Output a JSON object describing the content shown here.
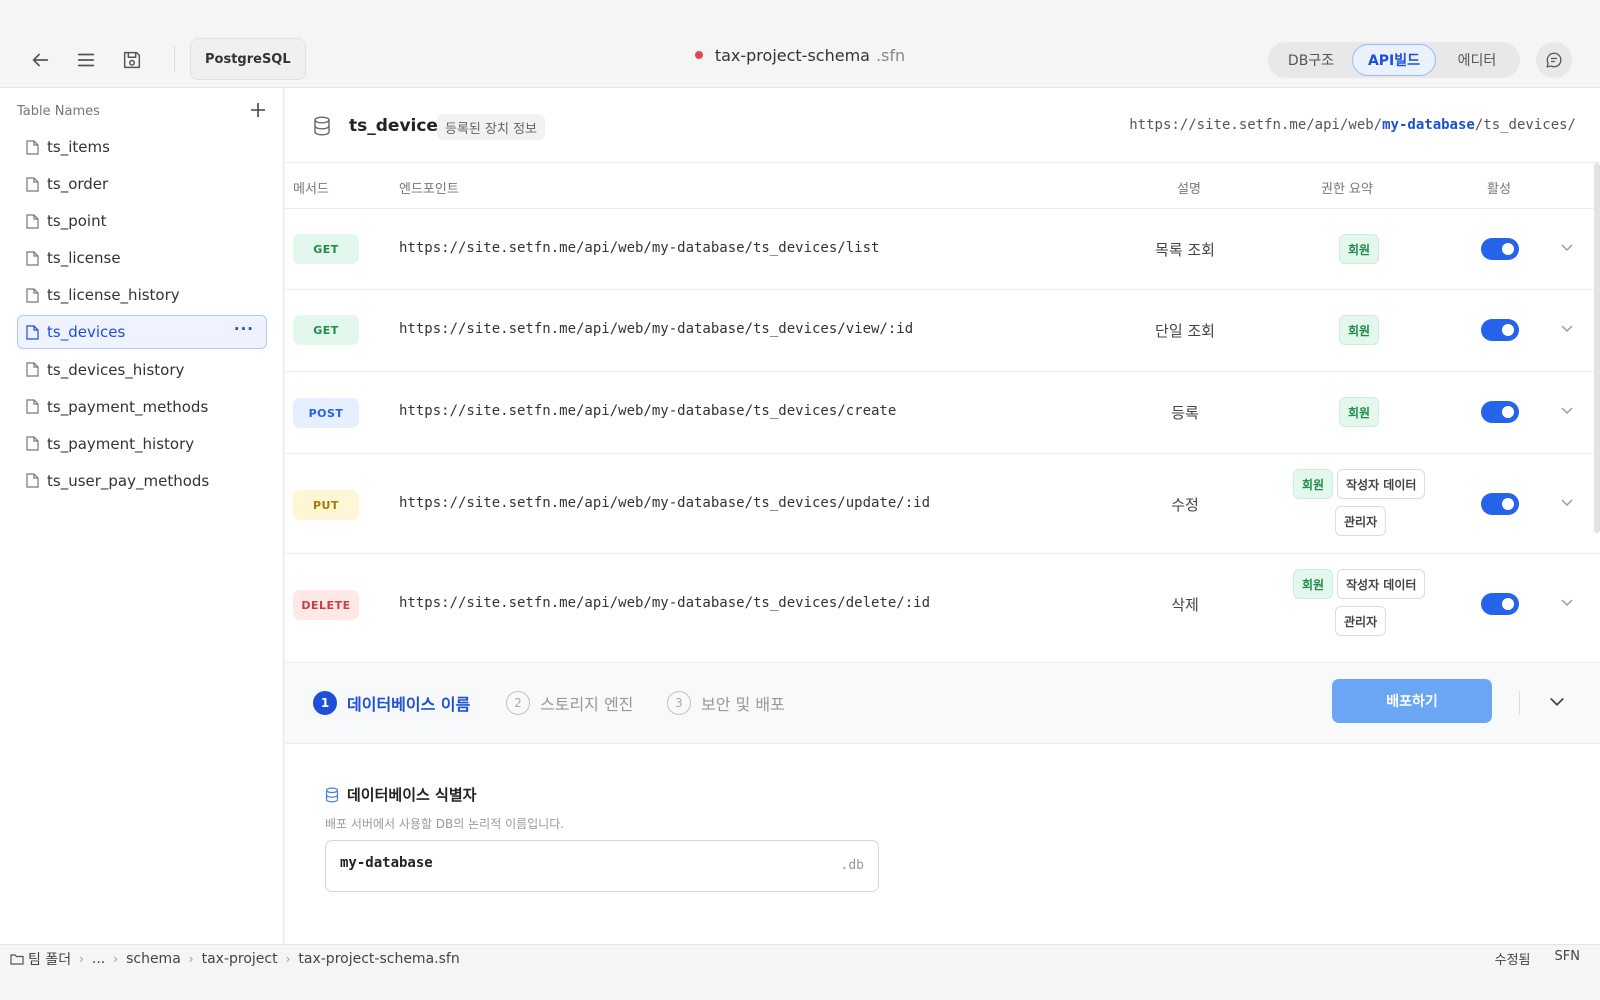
{
  "topbar": {
    "db_type": "PostgreSQL",
    "file_name": "tax-project-schema",
    "file_ext": ".sfn",
    "tabs": [
      {
        "label": "DB구조",
        "active": false
      },
      {
        "label": "API빌드",
        "active": true
      },
      {
        "label": "에디터",
        "active": false
      }
    ]
  },
  "sidebar": {
    "heading": "Table Names",
    "items": [
      {
        "label": "ts_items"
      },
      {
        "label": "ts_order"
      },
      {
        "label": "ts_point"
      },
      {
        "label": "ts_license"
      },
      {
        "label": "ts_license_history"
      },
      {
        "label": "ts_devices",
        "active": true
      },
      {
        "label": "ts_devices_history"
      },
      {
        "label": "ts_payment_methods"
      },
      {
        "label": "ts_payment_history"
      },
      {
        "label": "ts_user_pay_methods"
      }
    ],
    "more": "···"
  },
  "table": {
    "name": "ts_devices",
    "description": "등록된 장치 정보",
    "base_url": {
      "prefix": "https://site.setfn.me/api/web/",
      "db": "my-database",
      "suffix": "/ts_devices/"
    }
  },
  "columns": {
    "method": "메서드",
    "endpoint": "엔드포인트",
    "description": "설명",
    "permission": "권한 요약",
    "active": "활성"
  },
  "endpoints": [
    {
      "method": "GET",
      "url": "https://site.setfn.me/api/web/my-database/ts_devices/list",
      "description": "목록 조회",
      "permissions": [
        "회원"
      ],
      "active": true
    },
    {
      "method": "GET",
      "url": "https://site.setfn.me/api/web/my-database/ts_devices/view/:id",
      "description": "단일 조회",
      "permissions": [
        "회원"
      ],
      "active": true
    },
    {
      "method": "POST",
      "url": "https://site.setfn.me/api/web/my-database/ts_devices/create",
      "description": "등록",
      "permissions": [
        "회원"
      ],
      "active": true
    },
    {
      "method": "PUT",
      "url": "https://site.setfn.me/api/web/my-database/ts_devices/update/:id",
      "description": "수정",
      "permissions": [
        "회원",
        "작성자 데이터",
        "관리자"
      ],
      "active": true
    },
    {
      "method": "DELETE",
      "url": "https://site.setfn.me/api/web/my-database/ts_devices/delete/:id",
      "description": "삭제",
      "permissions": [
        "회원",
        "작성자 데이터",
        "관리자"
      ],
      "active": true
    }
  ],
  "deploy": {
    "steps": [
      {
        "num": "1",
        "label": "데이터베이스 이름",
        "active": true
      },
      {
        "num": "2",
        "label": "스토리지 엔진",
        "active": false
      },
      {
        "num": "3",
        "label": "보안 및 배포",
        "active": false
      }
    ],
    "button_label": "배포하기"
  },
  "identifier": {
    "title": "데이터베이스 식별자",
    "help": "배포 서버에서 사용할 DB의 논리적 이름입니다.",
    "value": "my-database",
    "suffix": ".db"
  },
  "statusbar": {
    "breadcrumb": [
      "팀 폴더",
      "...",
      "schema",
      "tax-project",
      "tax-project-schema.sfn"
    ],
    "status": "수정됨",
    "format": "SFN"
  },
  "colors": {
    "accent": "#1e4fd8",
    "toggle_on": "#2563eb",
    "deploy_button": "#6ba6f5",
    "unsaved_dot": "#e5484d"
  }
}
